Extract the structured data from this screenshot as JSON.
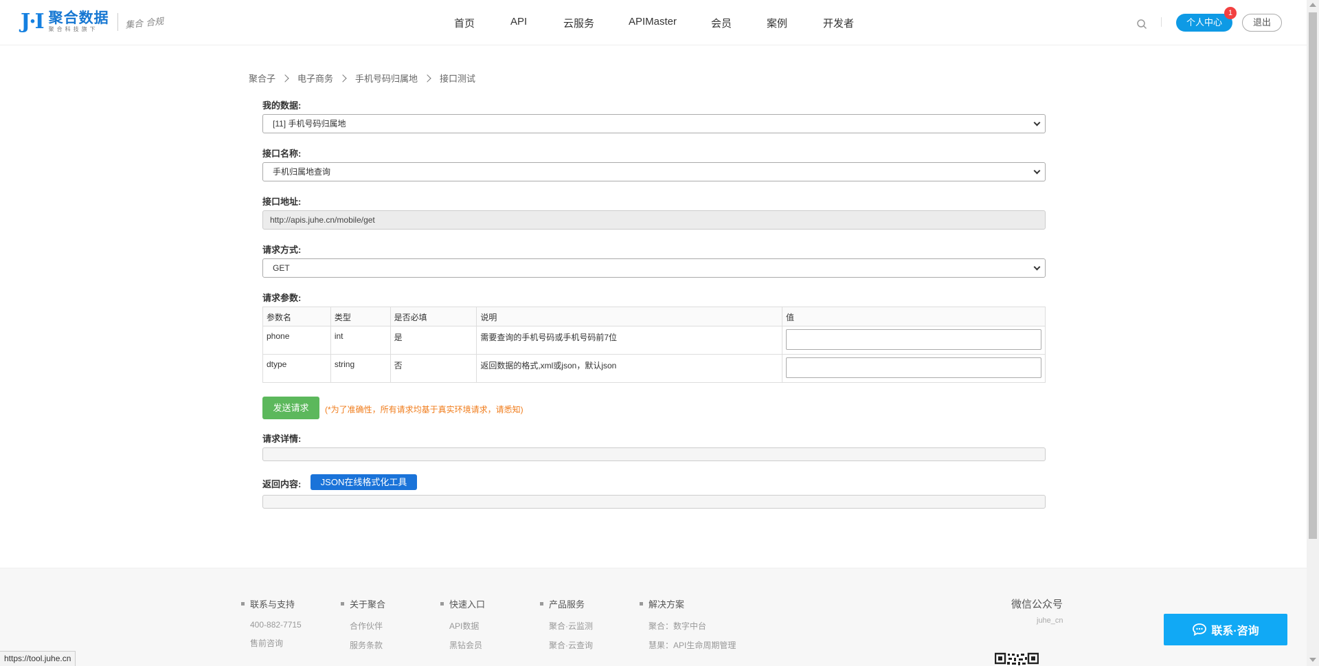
{
  "header": {
    "logo_mark": "J·I",
    "logo_name": "聚合数据",
    "logo_sub": "聚合科技旗下",
    "logo_slogan": "集合 合规",
    "nav": [
      "首页",
      "API",
      "云服务",
      "APIMaster",
      "会员",
      "案例",
      "开发者"
    ],
    "user_center_label": "个人中心",
    "notification_count": "1",
    "logout_label": "退出"
  },
  "breadcrumb": [
    "聚合子",
    "电子商务",
    "手机号码归属地",
    "接口测试"
  ],
  "form": {
    "my_data_label": "我的数据:",
    "my_data_value": "[11] 手机号码归属地",
    "api_name_label": "接口名称:",
    "api_name_value": "手机归属地查询",
    "api_url_label": "接口地址:",
    "api_url_value": "http://apis.juhe.cn/mobile/get",
    "method_label": "请求方式:",
    "method_value": "GET",
    "params_label": "请求参数:",
    "params_headers": [
      "参数名",
      "类型",
      "是否必填",
      "说明",
      "值"
    ],
    "params_rows": [
      {
        "name": "phone",
        "type": "int",
        "required": "是",
        "desc": "需要查询的手机号码或手机号码前7位"
      },
      {
        "name": "dtype",
        "type": "string",
        "required": "否",
        "desc": "返回数据的格式,xml或json，默认json"
      }
    ],
    "send_label": "发送请求",
    "send_note": "(*为了准确性，所有请求均基于真实环境请求，请悉知)",
    "request_detail_label": "请求详情:",
    "response_label": "返回内容:",
    "json_tool_label": "JSON在线格式化工具"
  },
  "footer": {
    "columns": [
      {
        "title": "联系与支持",
        "links": [
          "400-882-7715",
          "售前咨询"
        ]
      },
      {
        "title": "关于聚合",
        "links": [
          "合作伙伴",
          "服务条款"
        ]
      },
      {
        "title": "快速入口",
        "links": [
          "API数据",
          "黑钻会员"
        ]
      },
      {
        "title": "产品服务",
        "links": [
          "聚合·云监测",
          "聚合·云查询"
        ]
      },
      {
        "title": "解决方案",
        "links": [
          "聚合：数字中台",
          "慧果：API生命周期管理"
        ]
      }
    ],
    "wechat_title": "微信公众号",
    "wechat_id": "juhe_cn"
  },
  "consult_label": "联系·咨询",
  "status_url": "https://tool.juhe.cn",
  "colors": {
    "primary": "#0e9ae5",
    "send_button": "#5cb85c",
    "note": "#f07c1b",
    "json_button": "#1a73d9",
    "badge": "#f24040"
  }
}
